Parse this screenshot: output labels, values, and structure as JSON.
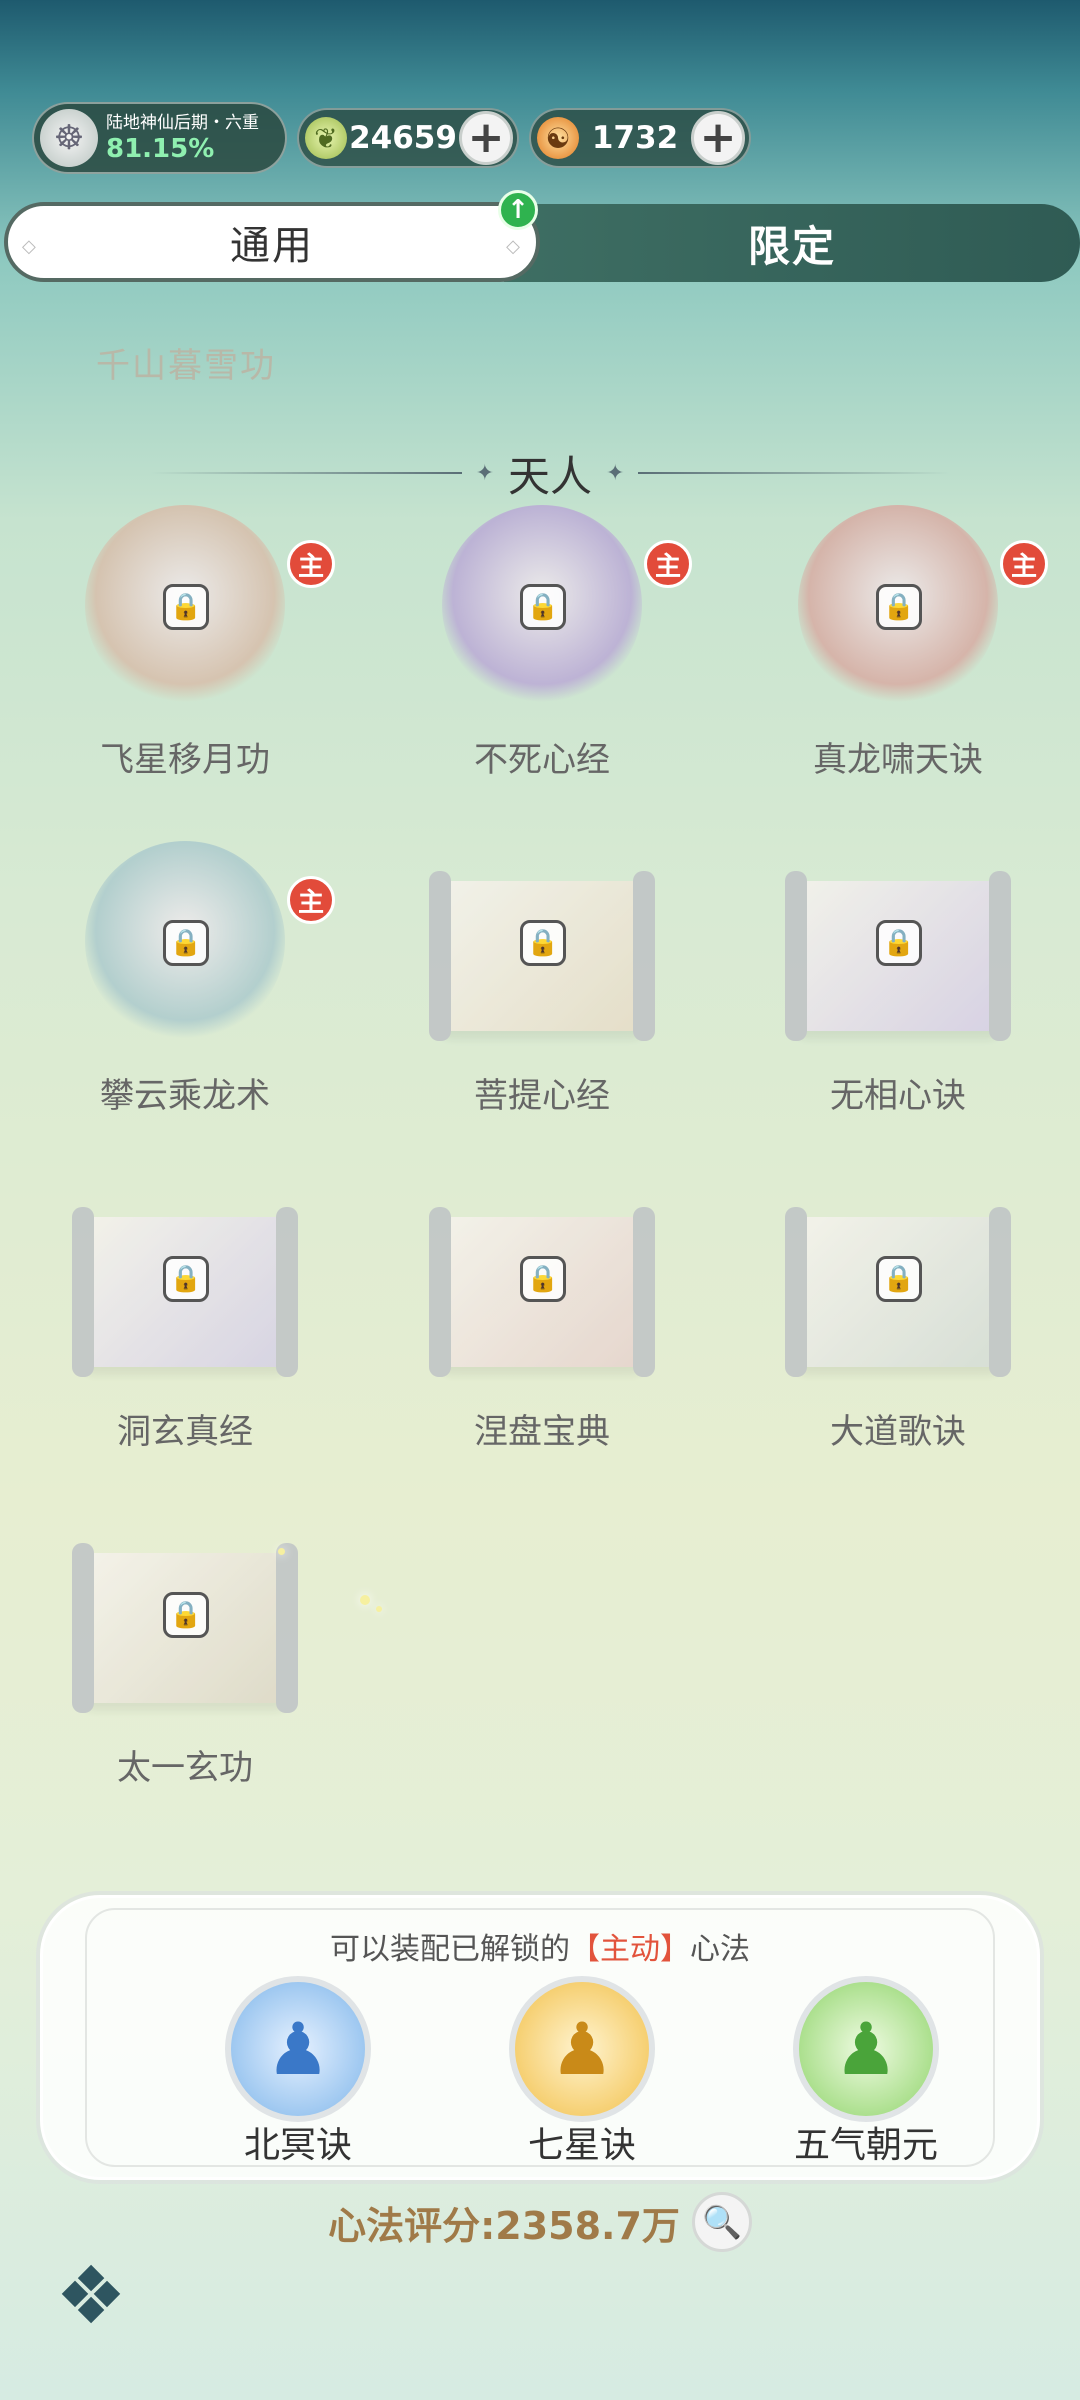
{
  "header": {
    "realm": {
      "name": "陆地神仙后期・六重",
      "progress": "81.15%"
    },
    "currencies": [
      {
        "icon": "jade-icon",
        "value": "24659",
        "color": "#c8e08a"
      },
      {
        "icon": "spirit-stone-icon",
        "value": "1732",
        "color": "#f0a040"
      }
    ]
  },
  "tabs": {
    "general": "通用",
    "limited": "限定"
  },
  "faded_title": "千山暮雪功",
  "section": {
    "title": "天人"
  },
  "skills": [
    {
      "name": "飞星移月功",
      "main": true,
      "main_label": "主",
      "art": "orb",
      "color": "#d8bba8"
    },
    {
      "name": "不死心经",
      "main": true,
      "main_label": "主",
      "art": "orb",
      "color": "#b9a6d6"
    },
    {
      "name": "真龙啸天诀",
      "main": true,
      "main_label": "主",
      "art": "orb",
      "color": "#d8a8a0"
    },
    {
      "name": "攀云乘龙术",
      "main": true,
      "main_label": "主",
      "art": "orb",
      "color": "#a9c8cc"
    },
    {
      "name": "菩提心经",
      "main": false,
      "art": "scroll",
      "color": "#e6dcc6"
    },
    {
      "name": "无相心诀",
      "main": false,
      "art": "scroll",
      "color": "#d6cde6"
    },
    {
      "name": "洞玄真经",
      "main": false,
      "art": "scroll",
      "color": "#d4cfe6"
    },
    {
      "name": "涅盘宝典",
      "main": false,
      "art": "scroll",
      "color": "#e6d2cc"
    },
    {
      "name": "大道歌诀",
      "main": false,
      "art": "scroll",
      "color": "#d4dcd6"
    },
    {
      "name": "太一玄功",
      "main": false,
      "art": "scroll",
      "color": "#ddd8c6"
    }
  ],
  "equip": {
    "caption_pre": "可以装配已解锁的",
    "caption_hl": "【主动】",
    "caption_post": "心法",
    "slots": [
      {
        "name": "北冥诀",
        "icon": "blue-figure-icon",
        "color": "#7fb6ea"
      },
      {
        "name": "七星诀",
        "icon": "gold-figure-icon",
        "color": "#f2c04a"
      },
      {
        "name": "五气朝元",
        "icon": "green-figure-icon",
        "color": "#8fd46a"
      }
    ]
  },
  "score": {
    "text": "心法评分:2358.7万"
  }
}
